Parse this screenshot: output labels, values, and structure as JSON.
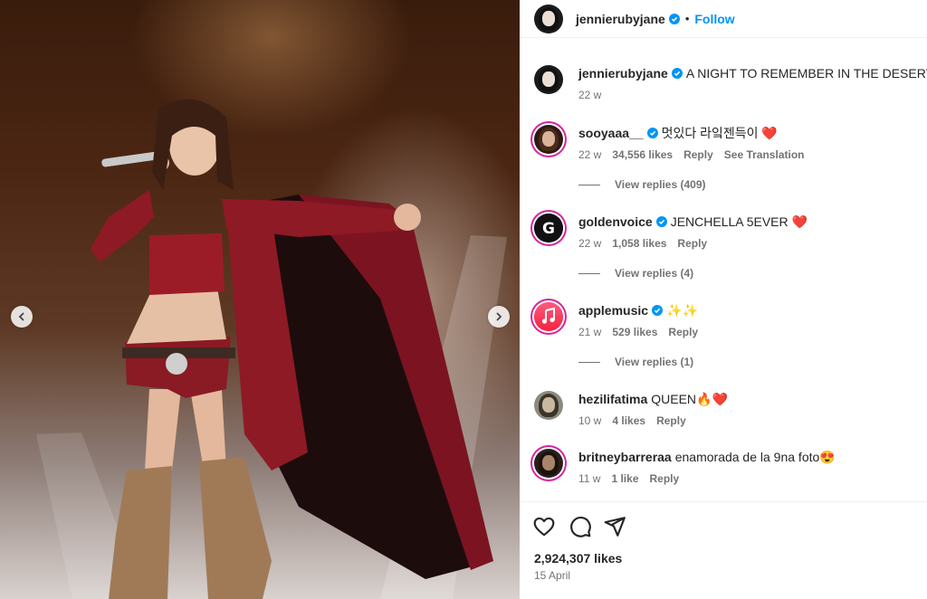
{
  "post": {
    "username": "jennierubyjane",
    "follow_label": "Follow",
    "separator": "•",
    "caption": "A NIGHT TO REMEMBER IN THE DESERT",
    "caption_time": "22 w",
    "likes": "2,924,307 likes",
    "date": "15 April"
  },
  "comments": [
    {
      "user": "sooyaaa__",
      "verified": true,
      "text": "멋있다 라잌젠득이 ❤️",
      "time": "22 w",
      "likes": "34,556 likes",
      "reply": "Reply",
      "translate": "See Translation",
      "view_replies": "View replies (409)"
    },
    {
      "user": "goldenvoice",
      "verified": true,
      "text": "JENCHELLA 5EVER ❤️",
      "time": "22 w",
      "likes": "1,058 likes",
      "reply": "Reply",
      "view_replies": "View replies (4)"
    },
    {
      "user": "applemusic",
      "verified": true,
      "text": "✨✨",
      "time": "21 w",
      "likes": "529 likes",
      "reply": "Reply",
      "view_replies": "View replies (1)"
    },
    {
      "user": "hezilifatima",
      "verified": false,
      "text": "QUEEN🔥❤️",
      "time": "10 w",
      "likes": "4 likes",
      "reply": "Reply"
    },
    {
      "user": "britneybarreraa",
      "verified": false,
      "text": "enamorada de la 9na foto😍",
      "time": "11 w",
      "likes": "1 like",
      "reply": "Reply"
    }
  ],
  "icons": {
    "prev": "chevron-left-icon",
    "next": "chevron-right-icon",
    "like": "heart-icon",
    "comment": "comment-icon",
    "share": "share-icon",
    "verified": "verified-badge-icon"
  },
  "colors": {
    "accent": "#0095f6",
    "verified": "#0095f6",
    "heart": "#ed4956"
  }
}
